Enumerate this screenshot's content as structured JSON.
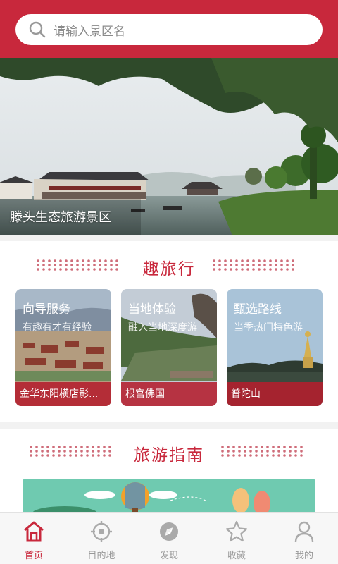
{
  "search": {
    "placeholder": "请输入景区名",
    "icon": "search-icon"
  },
  "banner": {
    "caption": "滕头生态旅游景区",
    "slides": 5,
    "active_slide": 0
  },
  "trip_section": {
    "title": "趣旅行",
    "cards": [
      {
        "title": "向导服务",
        "subtitle": "有趣有才有经验",
        "place": "金华东阳横店影..."
      },
      {
        "title": "当地体验",
        "subtitle": "融入当地深度游",
        "place": "根宫佛国"
      },
      {
        "title": "甄选路线",
        "subtitle": "当季热门特色游",
        "place": "普陀山"
      }
    ]
  },
  "guide_section": {
    "title": "旅游指南"
  },
  "nav": {
    "items": [
      {
        "label": "首页",
        "icon": "home-icon",
        "active": true
      },
      {
        "label": "目的地",
        "icon": "target-icon",
        "active": false
      },
      {
        "label": "发现",
        "icon": "compass-icon",
        "active": false
      },
      {
        "label": "收藏",
        "icon": "star-icon",
        "active": false
      },
      {
        "label": "我的",
        "icon": "user-icon",
        "active": false
      }
    ]
  },
  "colors": {
    "brand": "#c8283c",
    "inactive": "#999999"
  }
}
